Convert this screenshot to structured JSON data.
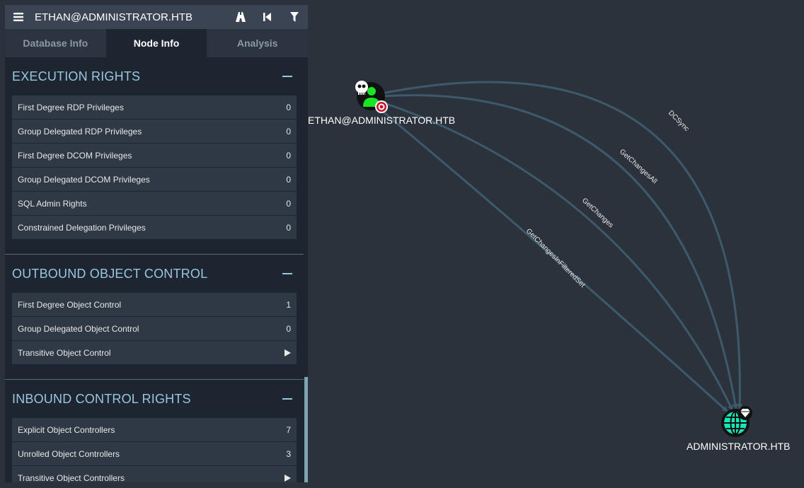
{
  "header": {
    "menu_icon": "hamburger-icon",
    "title": "ETHAN@ADMINISTRATOR.HTB",
    "icons": [
      "pathfinding-icon",
      "back-icon",
      "filter-icon"
    ]
  },
  "tabs": [
    {
      "label": "Database Info",
      "active": false
    },
    {
      "label": "Node Info",
      "active": true
    },
    {
      "label": "Analysis",
      "active": false
    }
  ],
  "sections": {
    "execution": {
      "title": "EXECUTION RIGHTS",
      "rows": [
        {
          "label": "First Degree RDP Privileges",
          "value": "0"
        },
        {
          "label": "Group Delegated RDP Privileges",
          "value": "0"
        },
        {
          "label": "First Degree DCOM Privileges",
          "value": "0"
        },
        {
          "label": "Group Delegated DCOM Privileges",
          "value": "0"
        },
        {
          "label": "SQL Admin Rights",
          "value": "0"
        },
        {
          "label": "Constrained Delegation Privileges",
          "value": "0"
        }
      ]
    },
    "outbound": {
      "title": "OUTBOUND OBJECT CONTROL",
      "rows": [
        {
          "label": "First Degree Object Control",
          "value": "1"
        },
        {
          "label": "Group Delegated Object Control",
          "value": "0"
        },
        {
          "label": "Transitive Object Control",
          "value": ""
        }
      ]
    },
    "inbound": {
      "title": "INBOUND CONTROL RIGHTS",
      "rows": [
        {
          "label": "Explicit Object Controllers",
          "value": "7"
        },
        {
          "label": "Unrolled Object Controllers",
          "value": "3"
        },
        {
          "label": "Transitive Object Controllers",
          "value": ""
        }
      ]
    }
  },
  "graph": {
    "source_node": {
      "label": "ETHAN@ADMINISTRATOR.HTB",
      "icons": [
        "user-icon",
        "skull-icon",
        "target-icon"
      ]
    },
    "target_node": {
      "label": "ADMINISTRATOR.HTB",
      "icons": [
        "domain-globe-icon",
        "diamond-icon"
      ]
    },
    "edges": [
      "DCSync",
      "GetChangesAll",
      "GetChanges",
      "GetChangesInFilteredSet"
    ]
  },
  "colors": {
    "background": "#2b323b",
    "edge": "#3d5a6c",
    "section_title": "#9bc5e0",
    "user_node": "#17e625",
    "domain_node": "#17e6b9"
  }
}
